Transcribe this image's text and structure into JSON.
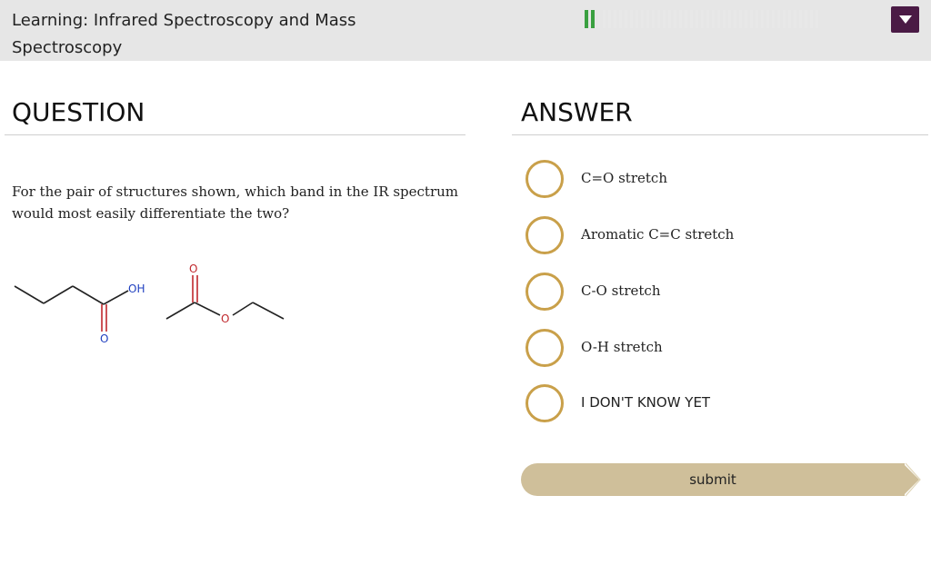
{
  "header": {
    "title": "Learning: Infrared Spectroscopy and Mass Spectroscopy",
    "progress": {
      "completed": 2,
      "total": 43
    },
    "colors": {
      "progress_done": "#3aa040",
      "progress_todo": "#e8e8e8",
      "menu": "#4a1a45"
    },
    "menu_icon": "caret-down-icon"
  },
  "question": {
    "heading": "QUESTION",
    "text": "For the pair of structures shown, which band in the IR spectrum would most easily differentiate the two?",
    "structure_labels": {
      "acid_oh": "OH",
      "acid_o": "O",
      "ester_carbonyl_o": "O",
      "ester_ring_o": "O"
    }
  },
  "answer": {
    "heading": "ANSWER",
    "choices": [
      {
        "label": "C=O stretch"
      },
      {
        "label": "Aromatic C=C stretch"
      },
      {
        "label": "C-O stretch"
      },
      {
        "label": "O-H stretch"
      },
      {
        "label": "I DON'T KNOW YET"
      }
    ],
    "radio_color": "#c9a04a"
  },
  "submit": {
    "label": "submit",
    "color": "#cfbf9a"
  }
}
